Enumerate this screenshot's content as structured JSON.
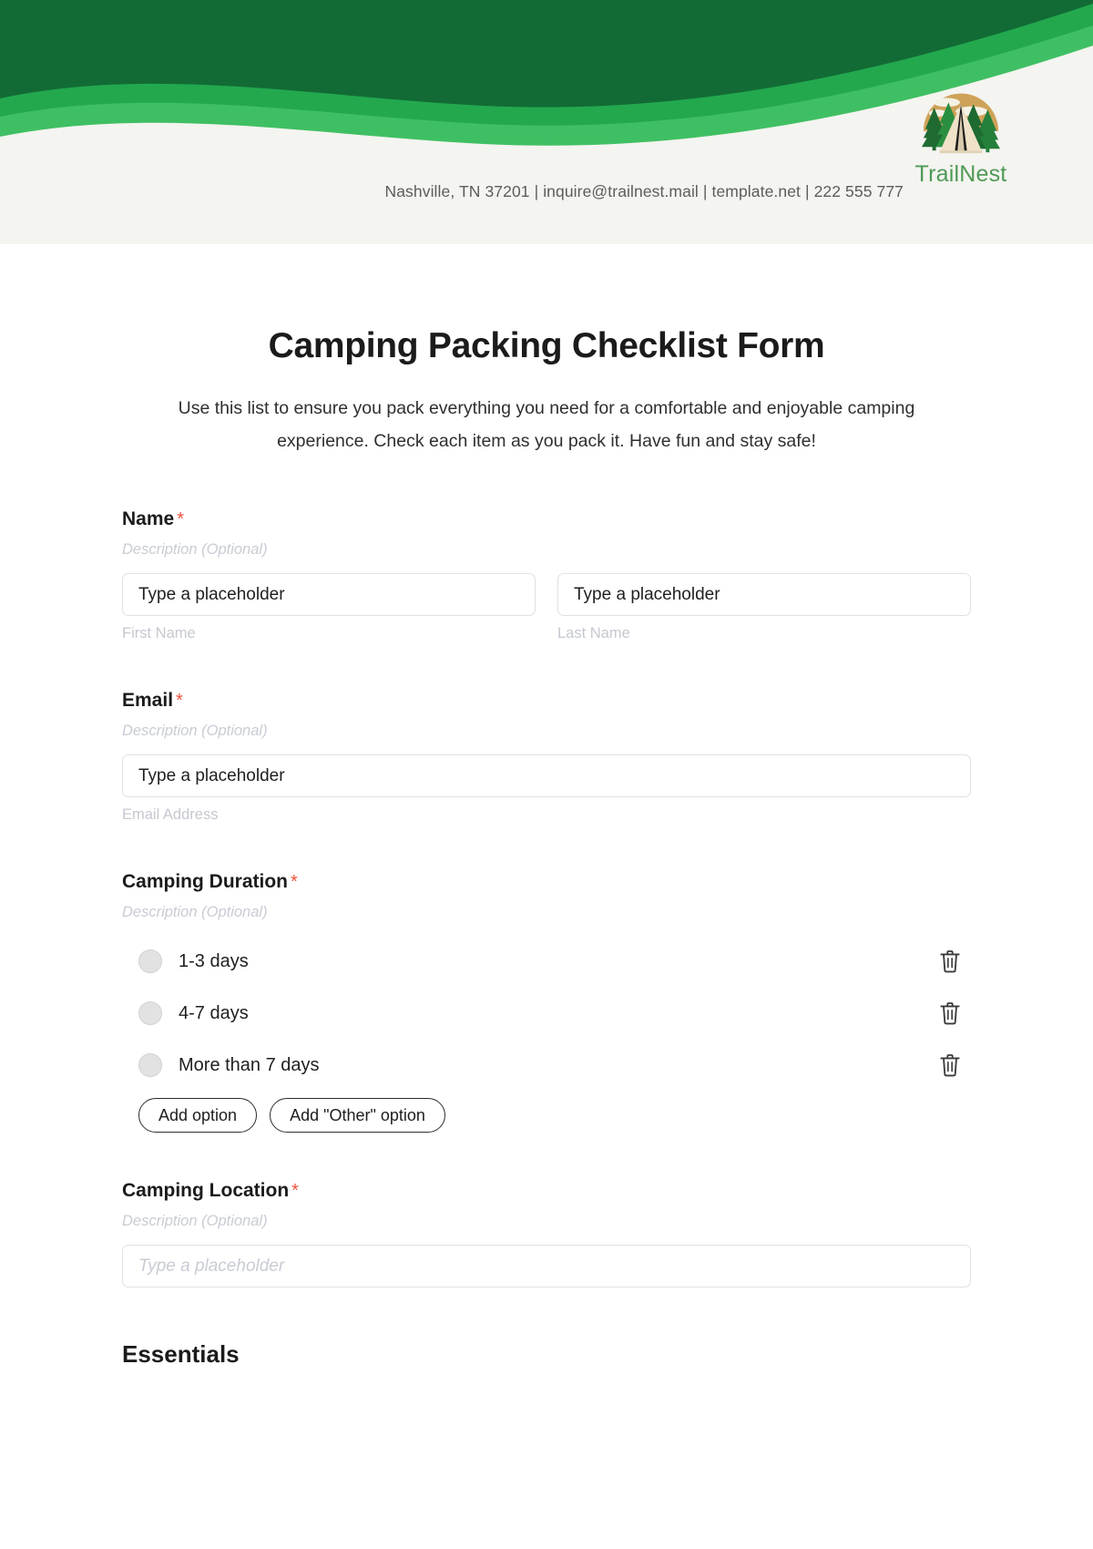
{
  "header": {
    "brand_name": "TrailNest",
    "logo_icon": "camping-tent-forest-icon",
    "contact_line": "Nashville, TN 37201 | inquire@trailnest.mail | template.net | 222 555 777",
    "wave_colors": {
      "dark_green": "#0d7a3d",
      "mid_green": "#23a84e",
      "light_green": "#3fbf63",
      "panel": "#f4f4f0"
    }
  },
  "form": {
    "title": "Camping Packing Checklist Form",
    "description": "Use this list to ensure you pack everything you need for a comfortable and enjoyable camping experience. Check each item as you pack it. Have fun and stay safe!",
    "required_marker": "*",
    "description_placeholder": "Description (Optional)",
    "fields": [
      {
        "label": "Name",
        "required": true,
        "description": "Description (Optional)",
        "inputs": [
          {
            "placeholder": "Type a placeholder",
            "caption": "First Name"
          },
          {
            "placeholder": "Type a placeholder",
            "caption": "Last Name"
          }
        ]
      },
      {
        "label": "Email",
        "required": true,
        "description": "Description (Optional)",
        "inputs": [
          {
            "placeholder": "Type a placeholder",
            "caption": "Email Address"
          }
        ]
      },
      {
        "label": "Camping Duration",
        "required": true,
        "description": "Description (Optional)",
        "options": [
          {
            "text": "1-3 days",
            "delete_icon": "trash-icon"
          },
          {
            "text": "4-7 days",
            "delete_icon": "trash-icon"
          },
          {
            "text": "More than 7 days",
            "delete_icon": "trash-icon"
          }
        ],
        "buttons": [
          {
            "label": "Add option"
          },
          {
            "label": "Add \"Other\" option"
          }
        ]
      },
      {
        "label": "Camping Location",
        "required": true,
        "description": "Description (Optional)",
        "inputs": [
          {
            "placeholder": "Type a placeholder",
            "caption": ""
          }
        ]
      }
    ],
    "section_heading": "Essentials"
  }
}
